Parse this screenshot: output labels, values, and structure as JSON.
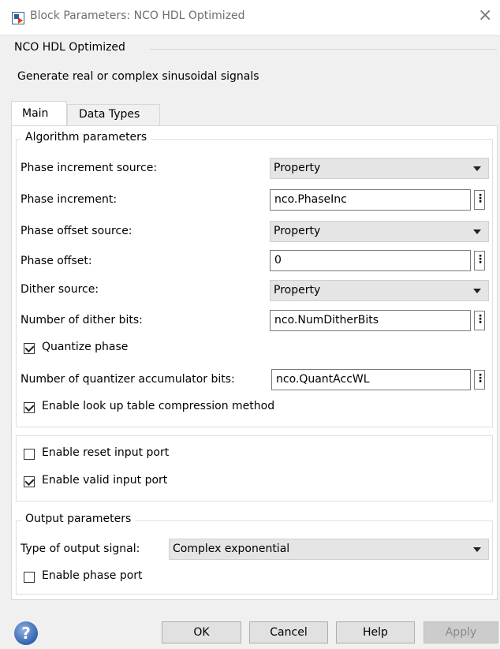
{
  "window": {
    "title": "Block Parameters: NCO HDL Optimized",
    "close_glyph": "×"
  },
  "header": {
    "block_name": "NCO HDL Optimized",
    "description": "Generate real or complex sinusoidal signals"
  },
  "tabs": [
    {
      "label": "Main",
      "active": true
    },
    {
      "label": "Data Types",
      "active": false
    }
  ],
  "algorithm": {
    "legend": "Algorithm parameters",
    "phase_increment_source": {
      "label": "Phase increment source:",
      "value": "Property"
    },
    "phase_increment": {
      "label": "Phase increment:",
      "value": "nco.PhaseInc"
    },
    "phase_offset_source": {
      "label": "Phase offset source:",
      "value": "Property"
    },
    "phase_offset": {
      "label": "Phase offset:",
      "value": "0"
    },
    "dither_source": {
      "label": "Dither source:",
      "value": "Property"
    },
    "num_dither_bits": {
      "label": "Number of dither bits:",
      "value": "nco.NumDitherBits"
    },
    "quantize_phase": {
      "label": "Quantize phase",
      "checked": true
    },
    "num_quantizer_bits": {
      "label": "Number of quantizer accumulator bits:",
      "value": "nco.QuantAccWL"
    },
    "lut_compression": {
      "label": "Enable look up table compression method",
      "checked": true
    }
  },
  "ports": {
    "reset": {
      "label": "Enable reset input port",
      "checked": false
    },
    "valid": {
      "label": "Enable valid input port",
      "checked": true
    }
  },
  "output": {
    "legend": "Output parameters",
    "type": {
      "label": "Type of output signal:",
      "value": "Complex exponential"
    },
    "phase_port": {
      "label": "Enable phase port",
      "checked": false
    }
  },
  "buttons": {
    "ok": "OK",
    "cancel": "Cancel",
    "help": "Help",
    "apply": "Apply",
    "help_glyph": "?"
  },
  "more_glyph": "⋮",
  "icons": {
    "help": "help-icon",
    "more": "more-options-icon",
    "dropdown": "chevron-down-icon"
  }
}
